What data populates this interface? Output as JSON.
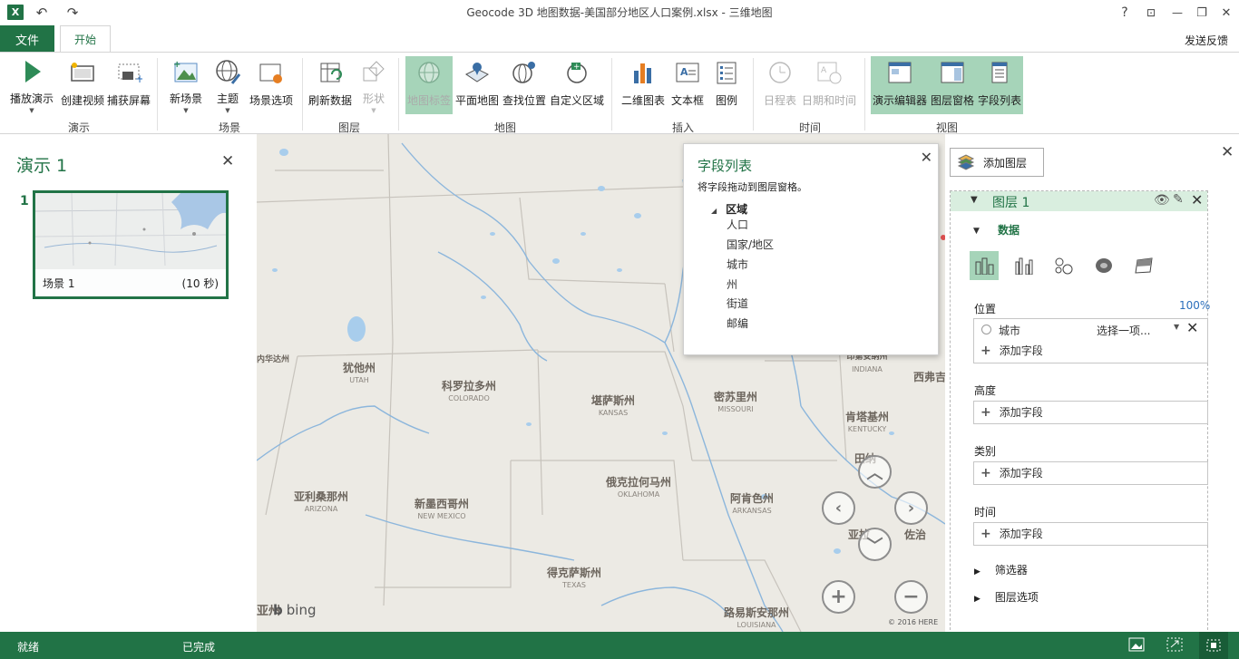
{
  "window": {
    "title": "Geocode 3D 地图数据-美国部分地区人口案例.xlsx - 三维地图",
    "help": "?",
    "minimize": "—",
    "restore": "❐",
    "close": "✕"
  },
  "tabs": {
    "file": "文件",
    "home": "开始",
    "feedback": "发送反馈"
  },
  "ribbon": {
    "groups": {
      "tour": "演示",
      "scene": "场景",
      "layer": "图层",
      "map": "地图",
      "insert": "插入",
      "time": "时间",
      "view": "视图"
    },
    "buttons": {
      "play_tour": "播放演示",
      "create_video": "创建视频",
      "capture_screen": "捕获屏幕",
      "new_scene": "新场景",
      "themes": "主题",
      "scene_options": "场景选项",
      "refresh_data": "刷新数据",
      "shapes": "形状",
      "map_labels": "地图标签",
      "flat_map": "平面地图",
      "find_location": "查找位置",
      "custom_regions": "自定义区域",
      "2d_chart": "二维图表",
      "text_box": "文本框",
      "legend": "图例",
      "timeline": "日程表",
      "date_time": "日期和时间",
      "tour_editor": "演示编辑器",
      "layer_pane": "图层窗格",
      "field_list": "字段列表"
    }
  },
  "tour_panel": {
    "title": "演示 1",
    "scene_number": "1",
    "scene_name": "场景 1",
    "scene_duration": "(10 秒)"
  },
  "map": {
    "states": [
      {
        "cn": "犹他州",
        "en": "UTAH"
      },
      {
        "cn": "科罗拉多州",
        "en": "COLORADO"
      },
      {
        "cn": "堪萨斯州",
        "en": "KANSAS"
      },
      {
        "cn": "密苏里州",
        "en": "MISSOURI"
      },
      {
        "cn": "肯塔基州",
        "en": "KENTUCKY"
      },
      {
        "cn": "亚利桑那州",
        "en": "ARIZONA"
      },
      {
        "cn": "新墨西哥州",
        "en": "NEW MEXICO"
      },
      {
        "cn": "俄克拉何马州",
        "en": "OKLAHOMA"
      },
      {
        "cn": "阿肯色州",
        "en": "ARKANSAS"
      },
      {
        "cn": "得克萨斯州",
        "en": "TEXAS"
      },
      {
        "cn": "路易斯安那州",
        "en": "LOUISIANA"
      },
      {
        "cn": "内华达州",
        "en": ""
      },
      {
        "cn": "印第安纳州",
        "en": "INDIANA"
      },
      {
        "cn": "西弗吉",
        "en": ""
      },
      {
        "cn": "田纳",
        "en": ""
      },
      {
        "cn": "亚拉",
        "en": ""
      },
      {
        "cn": "佐治",
        "en": ""
      }
    ],
    "bing": "bing",
    "copyright": "© 2016 HERE"
  },
  "field_list": {
    "title": "字段列表",
    "hint": "将字段拖动到图层窗格。",
    "table": "区域",
    "fields": [
      "人口",
      "国家/地区",
      "城市",
      "州",
      "街道",
      "邮编"
    ]
  },
  "layer_pane": {
    "add_layer": "添加图层",
    "layer_title": "图层 1",
    "data_section": "数据",
    "location_label": "位置",
    "confidence": "100%",
    "location_field": "城市",
    "location_type": "选择一项...",
    "add_field": "添加字段",
    "height_label": "高度",
    "category_label": "类别",
    "time_label": "时间",
    "filters": "筛选器",
    "layer_options": "图层选项"
  },
  "status": {
    "ready": "就绪",
    "done": "已完成"
  }
}
